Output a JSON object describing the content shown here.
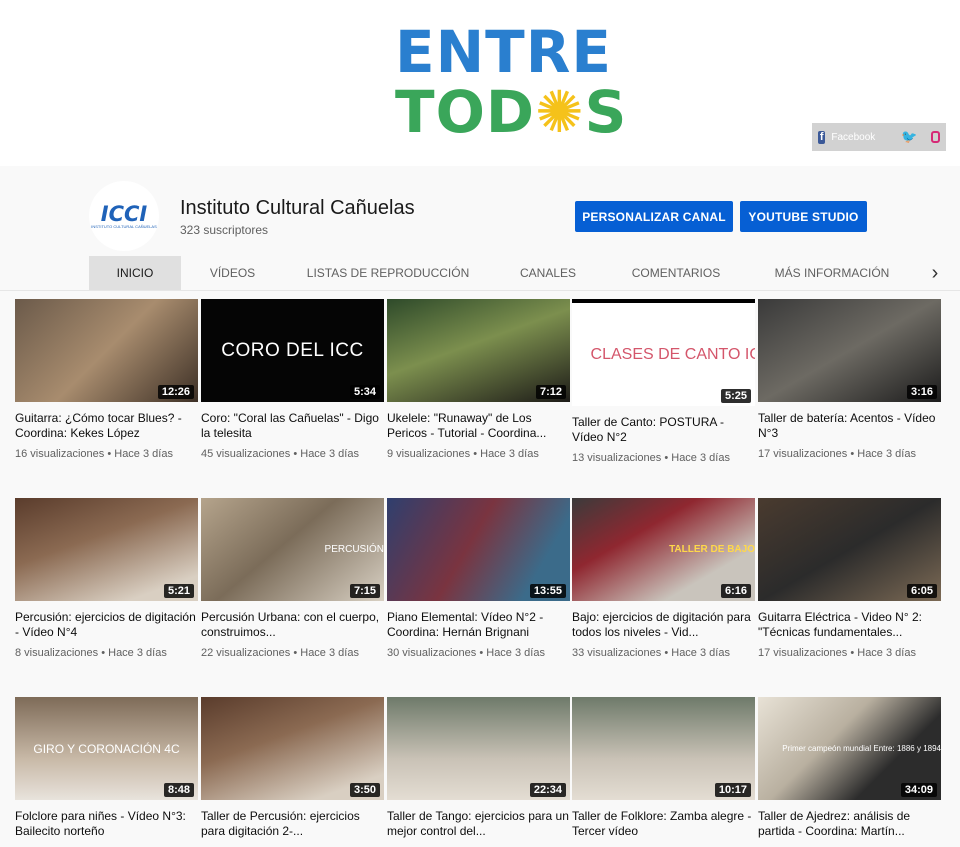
{
  "banner": {
    "logo_line1": "ENTRE",
    "logo_line2_a": "TOD",
    "logo_line2_sun": "✺",
    "logo_line2_b": "S",
    "social": {
      "facebook_label": "Facebook",
      "facebook_icon": "facebook-icon",
      "twitter_icon": "twitter-icon",
      "instagram_icon": "instagram-icon"
    }
  },
  "channel": {
    "avatar_text": "ICCI",
    "avatar_sub": "INSTITUTO CULTURAL CAÑUELAS",
    "name": "Instituto Cultural Cañuelas",
    "subscribers": "323 suscriptores",
    "customize_label": "PERSONALIZAR CANAL",
    "studio_label": "YOUTUBE STUDIO"
  },
  "tabs": [
    "INICIO",
    "VÍDEOS",
    "LISTAS DE REPRODUCCIÓN",
    "CANALES",
    "COMENTARIOS",
    "MÁS INFORMACIÓN"
  ],
  "tabs_more_icon": "chevron-right-icon",
  "videos": [
    {
      "title": "Guitarra: ¿Cómo tocar Blues? - Coordina: Kekes López",
      "views": "16 visualizaciones",
      "age": "Hace 3 días",
      "duration": "12:26",
      "thumb_text": ""
    },
    {
      "title": "Coro: \"Coral las Cañuelas\" - Digo la telesita",
      "views": "45 visualizaciones",
      "age": "Hace 3 días",
      "duration": "5:34",
      "thumb_text": "CORO DEL ICC"
    },
    {
      "title": "Ukelele: \"Runaway\" de Los Pericos - Tutorial - Coordina...",
      "views": "9 visualizaciones",
      "age": "Hace 3 días",
      "duration": "7:12",
      "thumb_text": ""
    },
    {
      "title": "Taller de Canto: POSTURA - Vídeo N°2",
      "views": "13 visualizaciones",
      "age": "Hace 3 días",
      "duration": "5:25",
      "thumb_text": "CLASES DE CANTO ICC"
    },
    {
      "title": "Taller de batería: Acentos - Vídeo N°3",
      "views": "17 visualizaciones",
      "age": "Hace 3 días",
      "duration": "3:16",
      "thumb_text": ""
    },
    {
      "title": "Percusión: ejercicios de digitación - Vídeo N°4",
      "views": "8 visualizaciones",
      "age": "Hace 3 días",
      "duration": "5:21",
      "thumb_text": ""
    },
    {
      "title": "Percusión Urbana: con el cuerpo, construimos...",
      "views": "22 visualizaciones",
      "age": "Hace 3 días",
      "duration": "7:15",
      "thumb_text": "PERCUSIÓN"
    },
    {
      "title": "Piano Elemental: Vídeo N°2 - Coordina: Hernán Brignani",
      "views": "30 visualizaciones",
      "age": "Hace 3 días",
      "duration": "13:55",
      "thumb_text": ""
    },
    {
      "title": "Bajo: ejercicios de digitación para todos los niveles - Vid...",
      "views": "33 visualizaciones",
      "age": "Hace 3 días",
      "duration": "6:16",
      "thumb_text": "TALLER DE BAJO"
    },
    {
      "title": "Guitarra Eléctrica - Video N° 2: \"Técnicas fundamentales...",
      "views": "17 visualizaciones",
      "age": "Hace 3 días",
      "duration": "6:05",
      "thumb_text": ""
    },
    {
      "title": "Folclore para niñes - Vídeo N°3: Bailecito norteño",
      "views": "",
      "age": "",
      "duration": "8:48",
      "thumb_text": "GIRO Y CORONACIÓN 4C"
    },
    {
      "title": "Taller de Percusión: ejercicios para digitación 2-...",
      "views": "",
      "age": "",
      "duration": "3:50",
      "thumb_text": ""
    },
    {
      "title": "Taller de Tango: ejercicios para un mejor control del...",
      "views": "",
      "age": "",
      "duration": "22:34",
      "thumb_text": ""
    },
    {
      "title": "Taller de Folklore: Zamba alegre - Tercer vídeo",
      "views": "",
      "age": "",
      "duration": "10:17",
      "thumb_text": ""
    },
    {
      "title": "Taller de Ajedrez: análisis de partida - Coordina: Martín...",
      "views": "",
      "age": "",
      "duration": "34:09",
      "thumb_text": "Primer campeón mundial Entre: 1886 y 1894"
    }
  ]
}
